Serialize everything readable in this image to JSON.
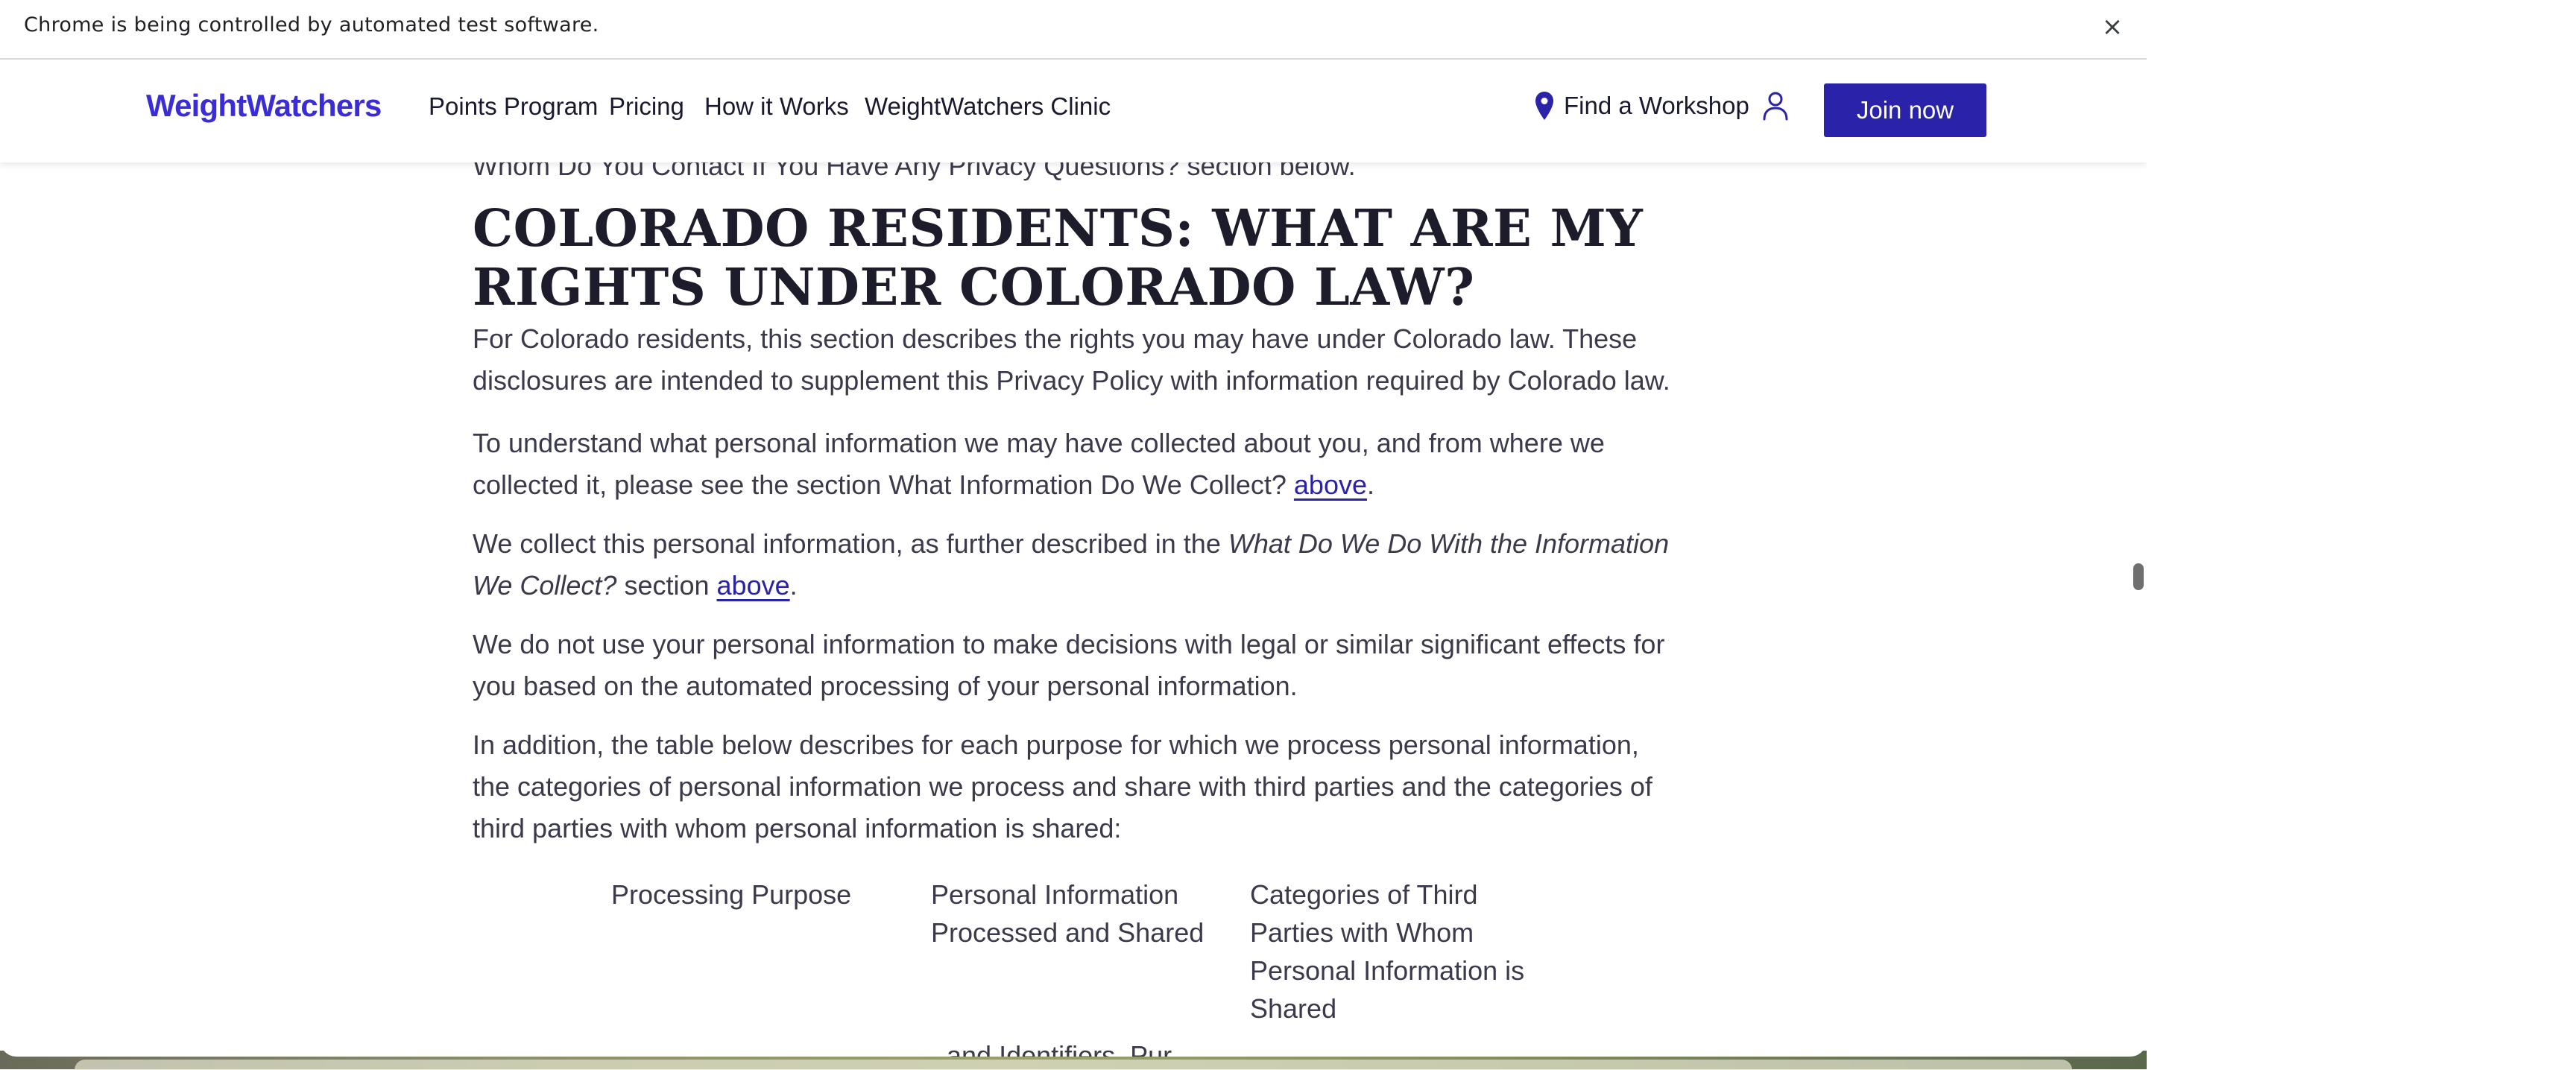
{
  "infobar": {
    "message": "Chrome is being controlled by automated test software.",
    "close_glyph": "×"
  },
  "header": {
    "logo": "WeightWatchers",
    "nav": [
      {
        "label": "Points Program"
      },
      {
        "label": "Pricing"
      },
      {
        "label": "How it Works"
      },
      {
        "label": "WeightWatchers Clinic"
      }
    ],
    "find_workshop": "Find a Workshop",
    "location_icon": "map-pin-icon",
    "account_icon": "user-icon",
    "join_label": "Join now",
    "colors": {
      "brand": "#3b2dd6",
      "button_bg": "#2a22a8"
    }
  },
  "content": {
    "prev_line": "Whom Do You Contact If You Have Any Privacy Questions? section below.",
    "heading": "COLORADO RESIDENTS: WHAT ARE MY RIGHTS UNDER COLORADO LAW?",
    "p1": "For Colorado residents, this section describes the rights you may have under Colorado law. These disclosures are intended to supplement this Privacy Policy with information required by Colorado law.",
    "p2_text": "To understand what personal information we may have collected about you, and from where we collected it, please see the section What Information Do We Collect?",
    "p2_link": "above",
    "p3_text": "We collect this personal information, as further described in the",
    "p3_italic": "What Do We Do With the Information We Collect?",
    "p3_after": "section",
    "p3_link": "above",
    "period": ".",
    "p4": "We do not use your personal information to make decisions with legal or similar significant effects for you based on the automated processing of your personal information.",
    "p5": "In addition, the table below describes for each purpose for which we process personal information, the categories of personal information we process and share with third parties and the categories of third parties with whom personal information is shared:",
    "table_headers": [
      "Processing Purpose",
      "Personal Information Processed and Shared",
      "Categories of Third Parties with Whom Personal Information is Shared"
    ],
    "cutoff_text": "and Identifiers, Pur"
  }
}
